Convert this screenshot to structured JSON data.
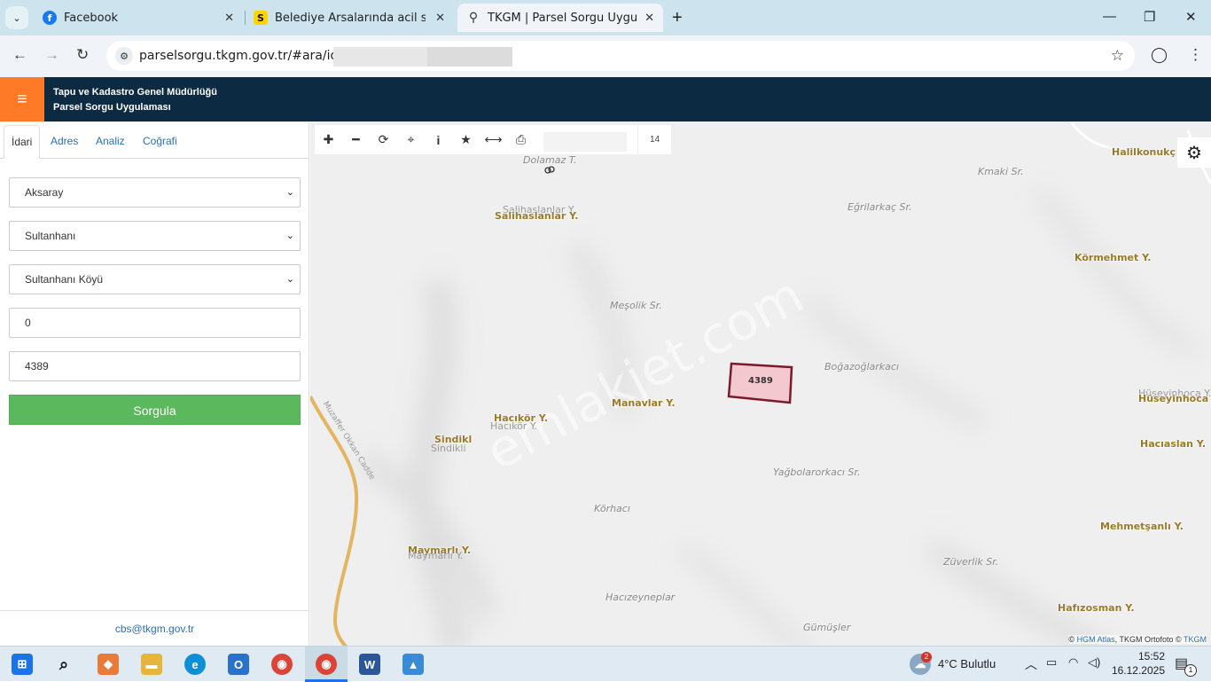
{
  "browser": {
    "tabs": [
      {
        "title": "Facebook",
        "icon": "facebook-icon",
        "color": "#1877f2"
      },
      {
        "title": "Belediye Arsalarında acil satılık",
        "icon": "s-logo-icon",
        "color": "#ffd400"
      },
      {
        "title": "TKGM | Parsel Sorgu Uygulaması",
        "icon": "location-pin-icon",
        "color": "#333333"
      }
    ],
    "url": "parselsorgu.tkgm.gov.tr/#ara/idari/"
  },
  "app": {
    "header_line1": "Tapu ve Kadastro Genel Müdürlüğü",
    "header_line2": "Parsel Sorgu Uygulaması",
    "header_color": "#0c2a42",
    "menu_color": "#ff7a26"
  },
  "sidebar": {
    "tabs": [
      "İdari",
      "Adres",
      "Analiz",
      "Coğrafi"
    ],
    "il": "Aksaray",
    "ilce": "Sultanhanı",
    "mahalle": "Sultanhanı Köyü",
    "ada": "0",
    "parsel": "4389",
    "button": "Sorgula",
    "footer_email": "cbs@tkgm.gov.tr"
  },
  "map": {
    "zoom": "14",
    "parcel_label": "4389",
    "watermark": "emlakjet.com",
    "labels": {
      "dolamaz": "Dolamaz T.",
      "salihaslanlar_sub": "Salihaslanlar Y.",
      "salihaslanlar": "Salihaslanlar Y.",
      "kmaki": "Kmaki Sr.",
      "egrilar": "Eğrilarkaç Sr.",
      "halilkonuk": "Halilkonukç",
      "kormehmet": "Körmehmet Y.",
      "mezarlik": "Meşolik Sr.",
      "bogazoglar": "Boğazoğlarkacı",
      "huseyinhoca_sub": "Hüseyinhoca Y.",
      "huseyinhoca": "Hüseyinhoca Y.",
      "manavlar": "Manavlar Y.",
      "hacikor": "Hacıkör Y.",
      "hacikor_sub": "Hacıkör Y.",
      "sindikli": "Sindikl",
      "sindikli_sub": "Sindikli",
      "haciaslan": "Hacıaslan Y.",
      "yagbolar": "Yağbolarorkacı Sr.",
      "road": "Muzaffer Okkan Cadde",
      "korhacı": "Körhacı",
      "mehmetsanli": "Mehmetşanlı Y.",
      "maymarli": "Maymarlı Y.",
      "maymarli_sub": "Maymarlı Y.",
      "zuverli": "Züverlik Sr.",
      "hacizeyne": "Hacızeyneplar",
      "gumusler": "Gümüşler",
      "hafizosman": "Hafızosman Y."
    },
    "attribution_prefix": "©",
    "attribution_link1": "HGM Atlas",
    "attribution_mid": ", TKGM Ortofoto ©",
    "attribution_link2": "TKGM"
  },
  "taskbar": {
    "weather_badge": "2",
    "weather": "4°C  Bulutlu",
    "time": "15:52",
    "date": "16.12.2025",
    "notif": "1"
  }
}
